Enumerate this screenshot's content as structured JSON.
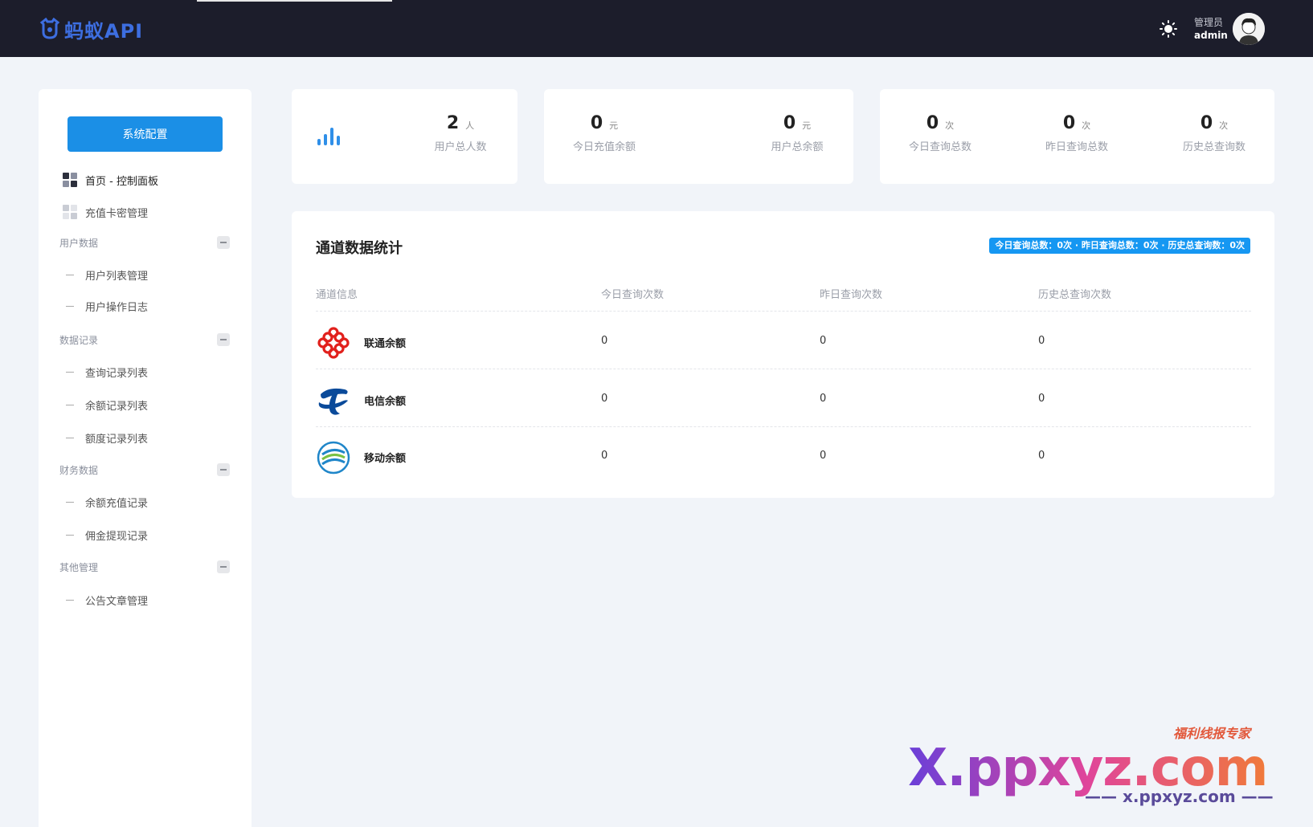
{
  "header": {
    "brand": "蚂蚁API",
    "role": "管理员",
    "username": "admin",
    "icons": [
      "sun-icon",
      "avatar"
    ]
  },
  "sidebar": {
    "config_button": "系统配置",
    "items": [
      {
        "label": "首页 - 控制面板",
        "icon": "dashboard-icon",
        "active": true
      },
      {
        "label": "充值卡密管理",
        "icon": "card-icon",
        "active": false
      }
    ],
    "groups": [
      {
        "title": "用户数据",
        "items": [
          "用户列表管理",
          "用户操作日志"
        ]
      },
      {
        "title": "数据记录",
        "items": [
          "查询记录列表",
          "余额记录列表",
          "额度记录列表"
        ]
      },
      {
        "title": "财务数据",
        "items": [
          "余额充值记录",
          "佣金提现记录"
        ]
      },
      {
        "title": "其他管理",
        "items": [
          "公告文章管理"
        ]
      }
    ]
  },
  "stats": {
    "users": {
      "value": "2",
      "unit": "人",
      "label": "用户总人数"
    },
    "today_recharge": {
      "value": "0",
      "unit": "元",
      "label": "今日充值余额"
    },
    "total_balance": {
      "value": "0",
      "unit": "元",
      "label": "用户总余额"
    },
    "today_queries": {
      "value": "0",
      "unit": "次",
      "label": "今日查询总数"
    },
    "yesterday_queries": {
      "value": "0",
      "unit": "次",
      "label": "昨日查询总数"
    },
    "history_queries": {
      "value": "0",
      "unit": "次",
      "label": "历史总查询数"
    }
  },
  "channels": {
    "title": "通道数据统计",
    "summary": "今日查询总数：0次 · 昨日查询总数：0次 · 历史总查询数：0次",
    "columns": [
      "通道信息",
      "今日查询次数",
      "昨日查询次数",
      "历史总查询次数"
    ],
    "rows": [
      {
        "name": "联通余额",
        "logo": "china-unicom-logo",
        "today": "0",
        "yesterday": "0",
        "history": "0"
      },
      {
        "name": "电信余额",
        "logo": "china-telecom-logo",
        "today": "0",
        "yesterday": "0",
        "history": "0"
      },
      {
        "name": "移动余额",
        "logo": "china-mobile-logo",
        "today": "0",
        "yesterday": "0",
        "history": "0"
      }
    ]
  },
  "watermark": {
    "main": "X.ppxyz.com",
    "sub": "—— x.ppxyz.com ——",
    "tag": "福利线报专家"
  }
}
